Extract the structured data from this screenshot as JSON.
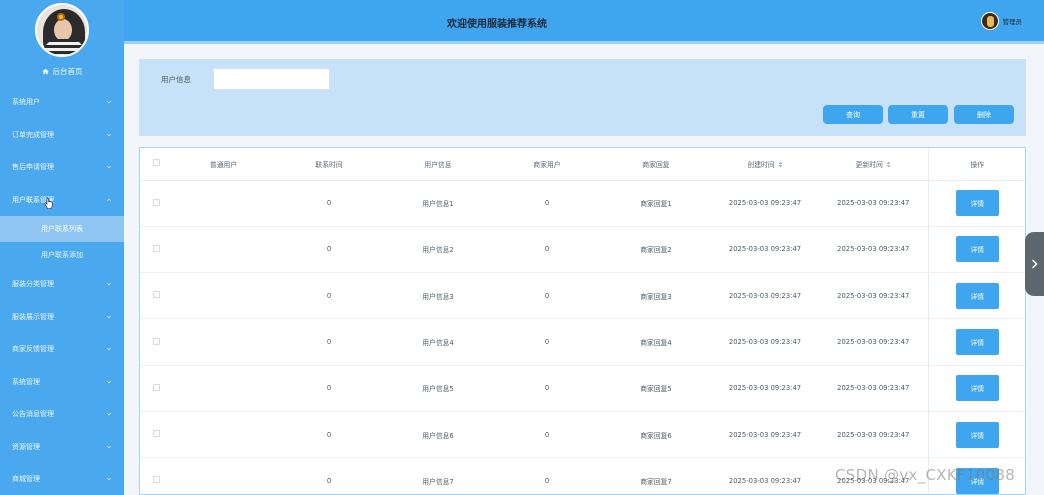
{
  "app": {
    "title": "欢迎使用服装推荐系统"
  },
  "user": {
    "name": "管理员"
  },
  "sidebar": {
    "home_label": "后台首页",
    "items": [
      {
        "label": "系统用户"
      },
      {
        "label": "订单完成管理"
      },
      {
        "label": "售后申请管理"
      },
      {
        "label": "用户联系管理",
        "open": true,
        "children": [
          {
            "label": "用户联系列表",
            "active": true
          },
          {
            "label": "用户联系添加"
          }
        ]
      },
      {
        "label": "服装分类管理"
      },
      {
        "label": "服装展示管理"
      },
      {
        "label": "商家反馈管理"
      },
      {
        "label": "系统管理"
      },
      {
        "label": "公告消息管理"
      },
      {
        "label": "资源管理"
      },
      {
        "label": "商城管理"
      }
    ]
  },
  "search": {
    "label": "用户信息",
    "value": "",
    "query_button": "查询",
    "reset_button": "重置",
    "delete_button": "删除"
  },
  "table": {
    "columns": [
      "普通用户",
      "联系时间",
      "用户信息",
      "商家用户",
      "商家回复",
      "创建时间",
      "更新时间",
      "操作"
    ],
    "detail_label": "详情",
    "rows": [
      {
        "user": "",
        "time": "0",
        "info": "用户信息1",
        "merchant": "0",
        "reply": "商家回复1",
        "created": "2025-03-03 09:23:47",
        "updated": "2025-03-03 09:23:47"
      },
      {
        "user": "",
        "time": "0",
        "info": "用户信息2",
        "merchant": "0",
        "reply": "商家回复2",
        "created": "2025-03-03 09:23:47",
        "updated": "2025-03-03 09:23:47"
      },
      {
        "user": "",
        "time": "0",
        "info": "用户信息3",
        "merchant": "0",
        "reply": "商家回复3",
        "created": "2025-03-03 09:23:47",
        "updated": "2025-03-03 09:23:47"
      },
      {
        "user": "",
        "time": "0",
        "info": "用户信息4",
        "merchant": "0",
        "reply": "商家回复4",
        "created": "2025-03-03 09:23:47",
        "updated": "2025-03-03 09:23:47"
      },
      {
        "user": "",
        "time": "0",
        "info": "用户信息5",
        "merchant": "0",
        "reply": "商家回复5",
        "created": "2025-03-03 09:23:47",
        "updated": "2025-03-03 09:23:47"
      },
      {
        "user": "",
        "time": "0",
        "info": "用户信息6",
        "merchant": "0",
        "reply": "商家回复6",
        "created": "2025-03-03 09:23:47",
        "updated": "2025-03-03 09:23:47"
      },
      {
        "user": "",
        "time": "0",
        "info": "用户信息7",
        "merchant": "0",
        "reply": "商家回复7",
        "created": "2025-03-03 09:23:47",
        "updated": "2025-03-03 09:23:47"
      }
    ]
  },
  "watermark": "CSDN @vx_CXKF10088",
  "colors": {
    "primary": "#3ea6ee",
    "sidebar": "#4aa9ee",
    "header": "#3fa5ef",
    "panel": "#c7e2f8"
  },
  "icons": {
    "home": "home-icon",
    "chevron": "chevron-down-icon",
    "expand": "chevron-right-icon"
  }
}
